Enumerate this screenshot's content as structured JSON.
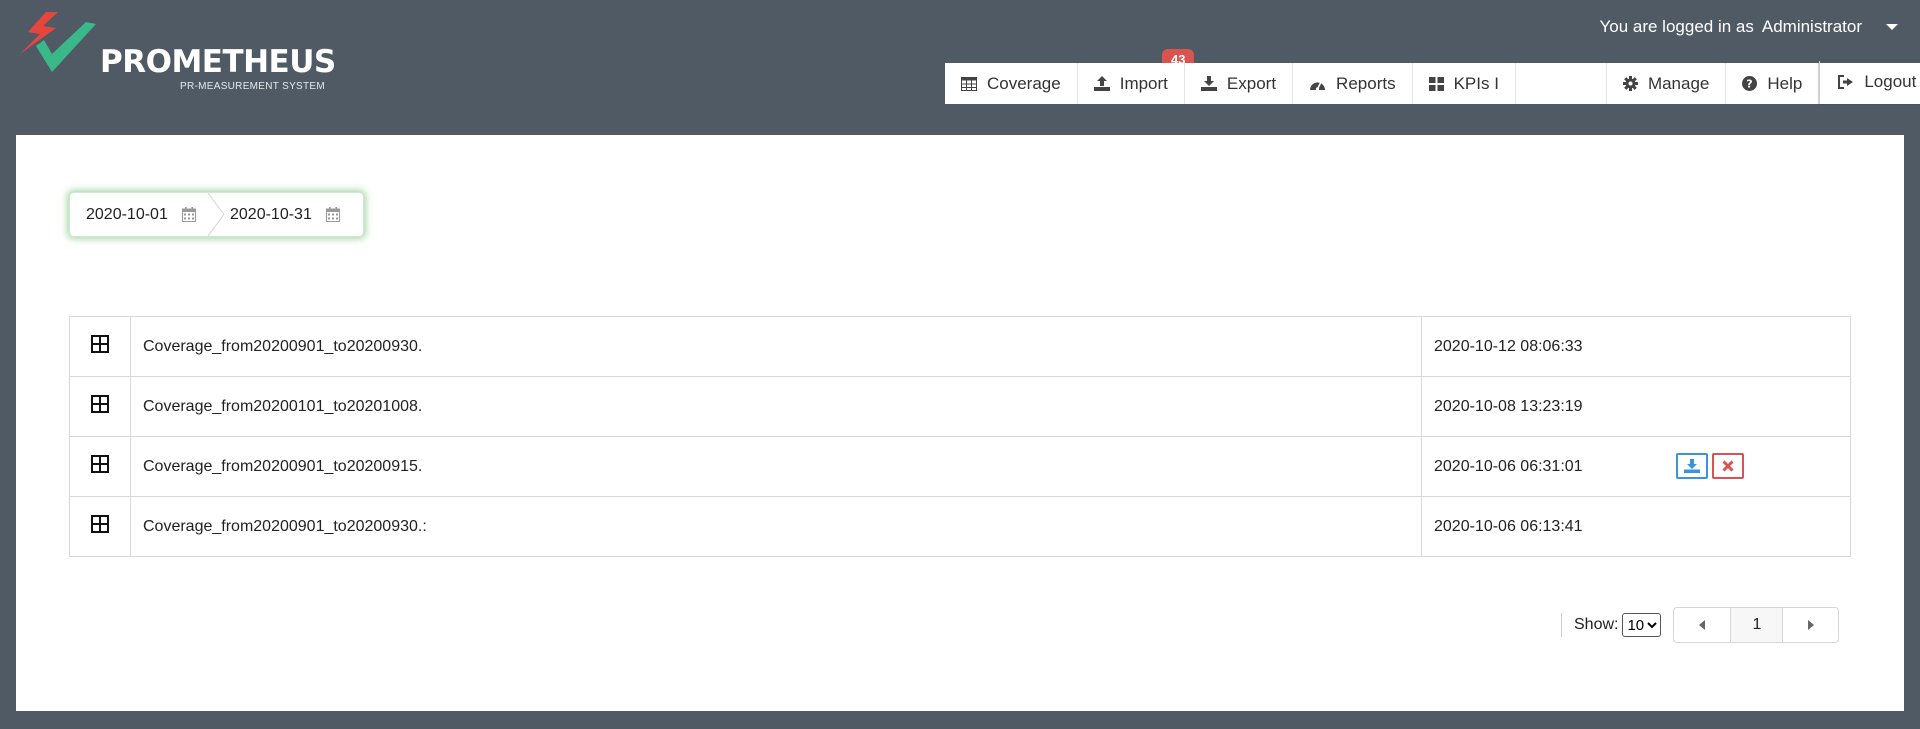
{
  "brand": {
    "name": "PROMETHEUS",
    "subtitle": "PR-MEASUREMENT SYSTEM",
    "colors": {
      "red": "#e8453c",
      "green": "#3bb88a"
    }
  },
  "user": {
    "prefix": "You are logged in as",
    "name": "Administrator"
  },
  "nav": {
    "coverage": "Coverage",
    "import": "Import",
    "import_badge": "43",
    "export": "Export",
    "reports": "Reports",
    "kpis": "KPIs I",
    "manage": "Manage",
    "help": "Help",
    "logout": "Logout"
  },
  "daterange": {
    "start": "2020-10-01",
    "end": "2020-10-31"
  },
  "files": [
    {
      "name": "Coverage_from20200901_to20200930.",
      "date": "2020-10-12 08:06:33"
    },
    {
      "name": "Coverage_from20200101_to20201008.",
      "date": "2020-10-08 13:23:19"
    },
    {
      "name": "Coverage_from20200901_to20200915.",
      "date": "2020-10-06 06:31:01"
    },
    {
      "name": "Coverage_from20200901_to20200930.:",
      "date": "2020-10-06 06:13:41"
    }
  ],
  "pagination": {
    "show_label": "Show:",
    "page_size": "10",
    "page_size_options": [
      "10"
    ],
    "current_page": "1"
  },
  "colors": {
    "header_bg": "#505a65",
    "badge": "#d9534f",
    "download": "#3a95d8",
    "delete": "#d9534f",
    "date_focus": "#5cb85c"
  }
}
